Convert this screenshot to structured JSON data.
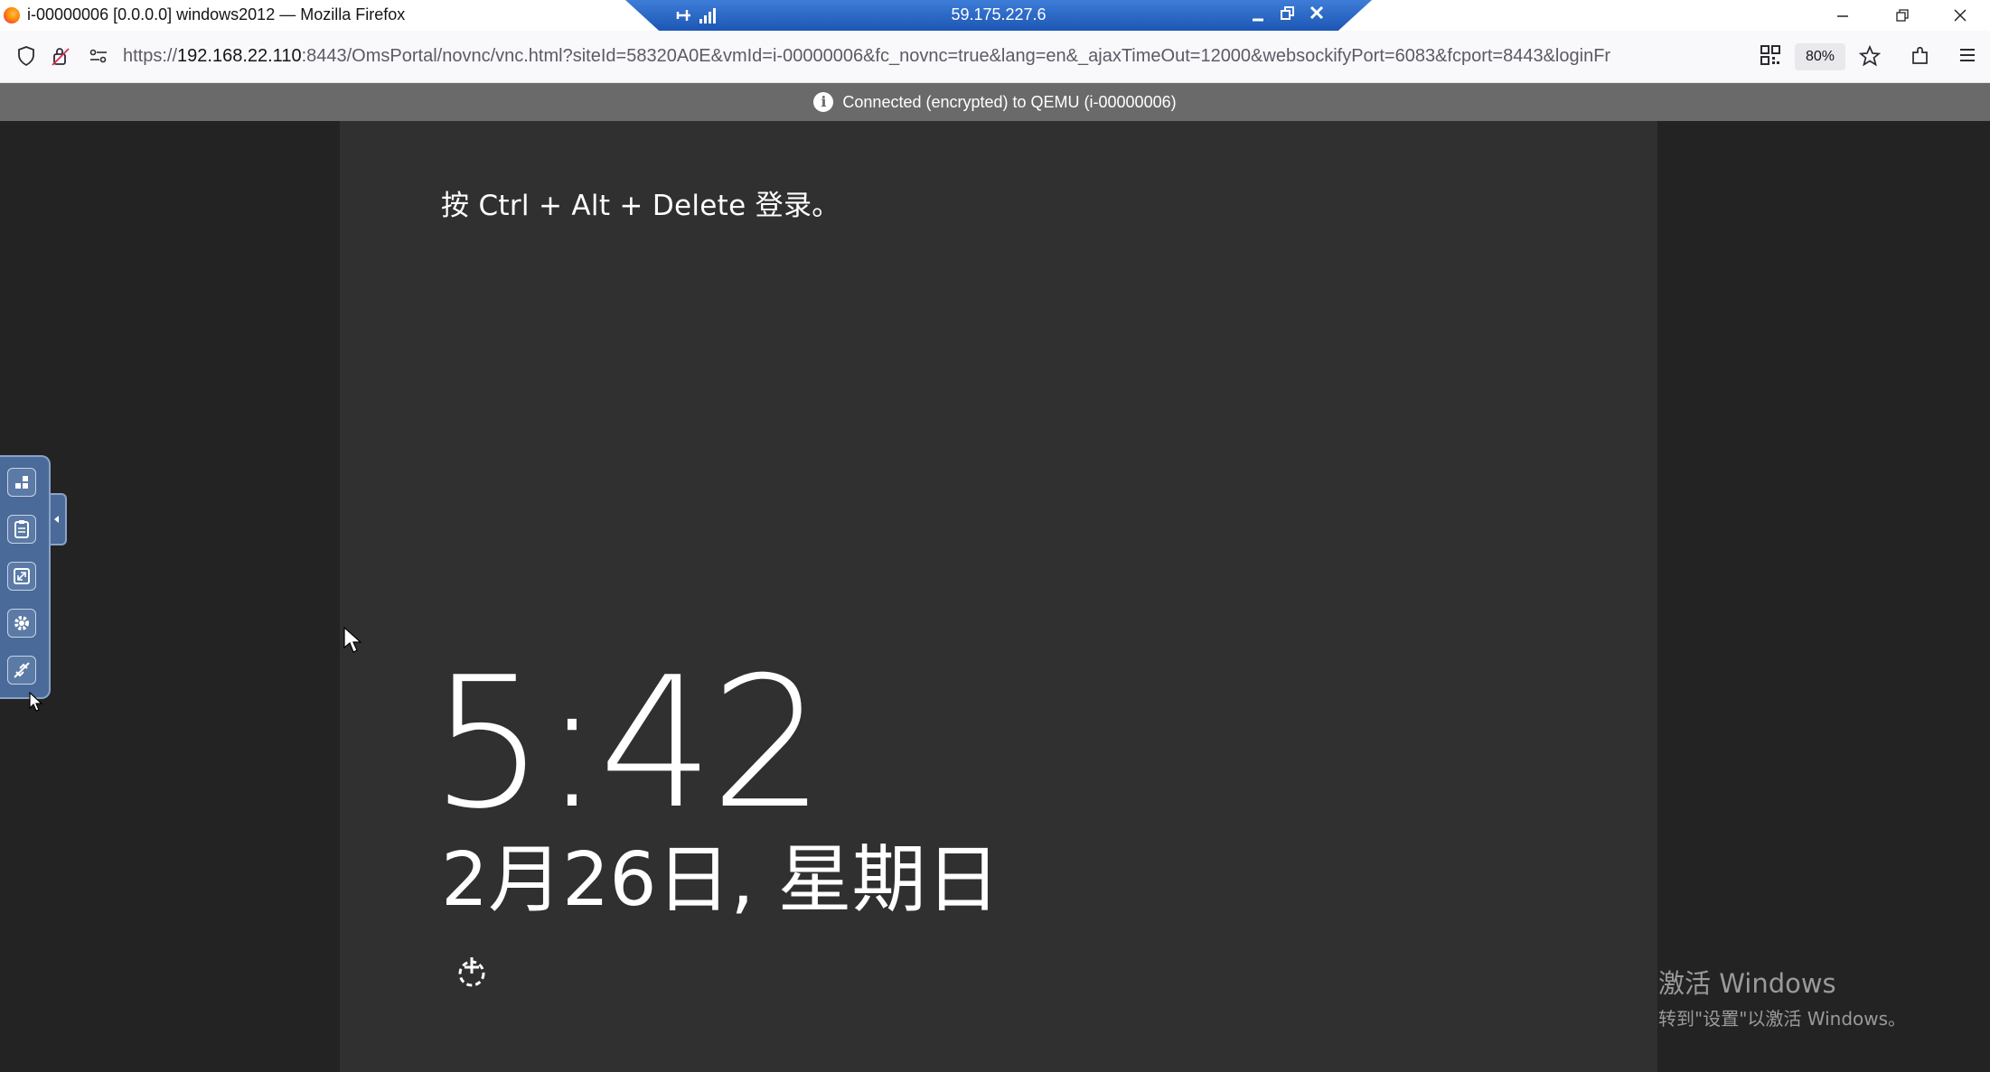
{
  "browser": {
    "window_title": "i-00000006 [0.0.0.0] windows2012 — Mozilla Firefox",
    "url_prefix": "https://",
    "url_host": "192.168.22.110",
    "url_rest": ":8443/OmsPortal/novnc/vnc.html?siteId=58320A0E&vmId=i-00000006&fc_novnc=true&lang=en&_ajaxTimeOut=12000&websockifyPort=6083&fcport=8443&loginFr",
    "zoom_level": "80%"
  },
  "rdp_bar": {
    "host": "59.175.227.6"
  },
  "vnc": {
    "status_text": "Connected (encrypted) to QEMU (i-00000006)"
  },
  "lock_screen": {
    "prompt": "按 Ctrl + Alt + Delete 登录。",
    "time": "5:42",
    "date": "2月26日, 星期日"
  },
  "watermark": {
    "line1": "激活 Windows",
    "line2": "转到\"设置\"以激活 Windows。"
  },
  "colors": {
    "rdp_bar": "#1d56b4",
    "vnc_status_bar": "#6a6a6a",
    "screen_bg": "#303030",
    "vnc_control_bar": "#4a6a99"
  },
  "icons": {
    "vnc_controls": [
      "extra-keys-icon",
      "clipboard-icon",
      "fullscreen-icon",
      "settings-icon",
      "disconnect-icon"
    ]
  }
}
